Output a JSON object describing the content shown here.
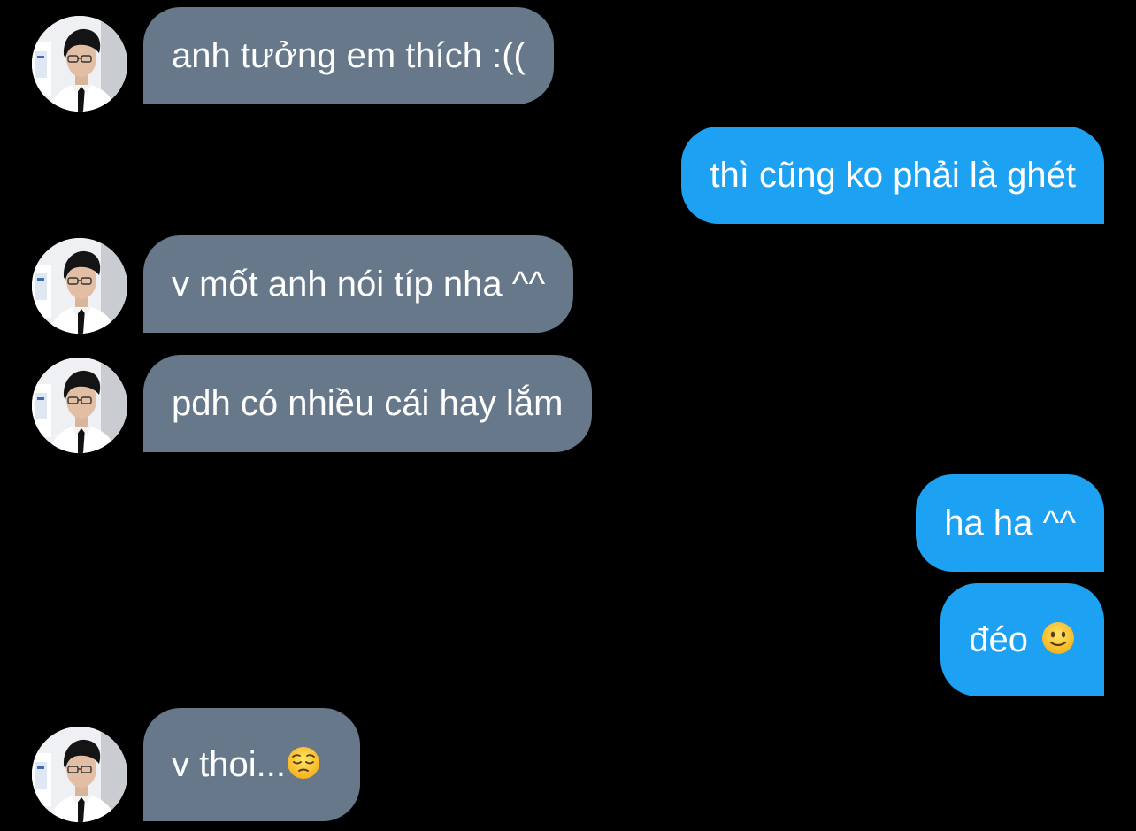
{
  "conversation": {
    "messages": [
      {
        "direction": "incoming",
        "text": "anh tưởng em thích :(("
      },
      {
        "direction": "outgoing",
        "text": "thì cũng ko phải là ghét"
      },
      {
        "direction": "incoming",
        "text": "v mốt anh nói típ nha ^^"
      },
      {
        "direction": "incoming",
        "text": "pdh có nhiều cái hay lắm"
      },
      {
        "direction": "outgoing",
        "text": "ha ha ^^"
      },
      {
        "direction": "outgoing",
        "text": "đéo",
        "emoji": "slightly-smiling-face-emoji"
      },
      {
        "direction": "incoming",
        "text": "v thoi...",
        "emoji": "pensive-face-emoji"
      }
    ]
  },
  "colors": {
    "background": "#000000",
    "incoming_bubble": "#66788a",
    "outgoing_bubble": "#1da1f2",
    "text": "#ffffff"
  },
  "icons": {
    "avatar": "avatar-photo"
  }
}
